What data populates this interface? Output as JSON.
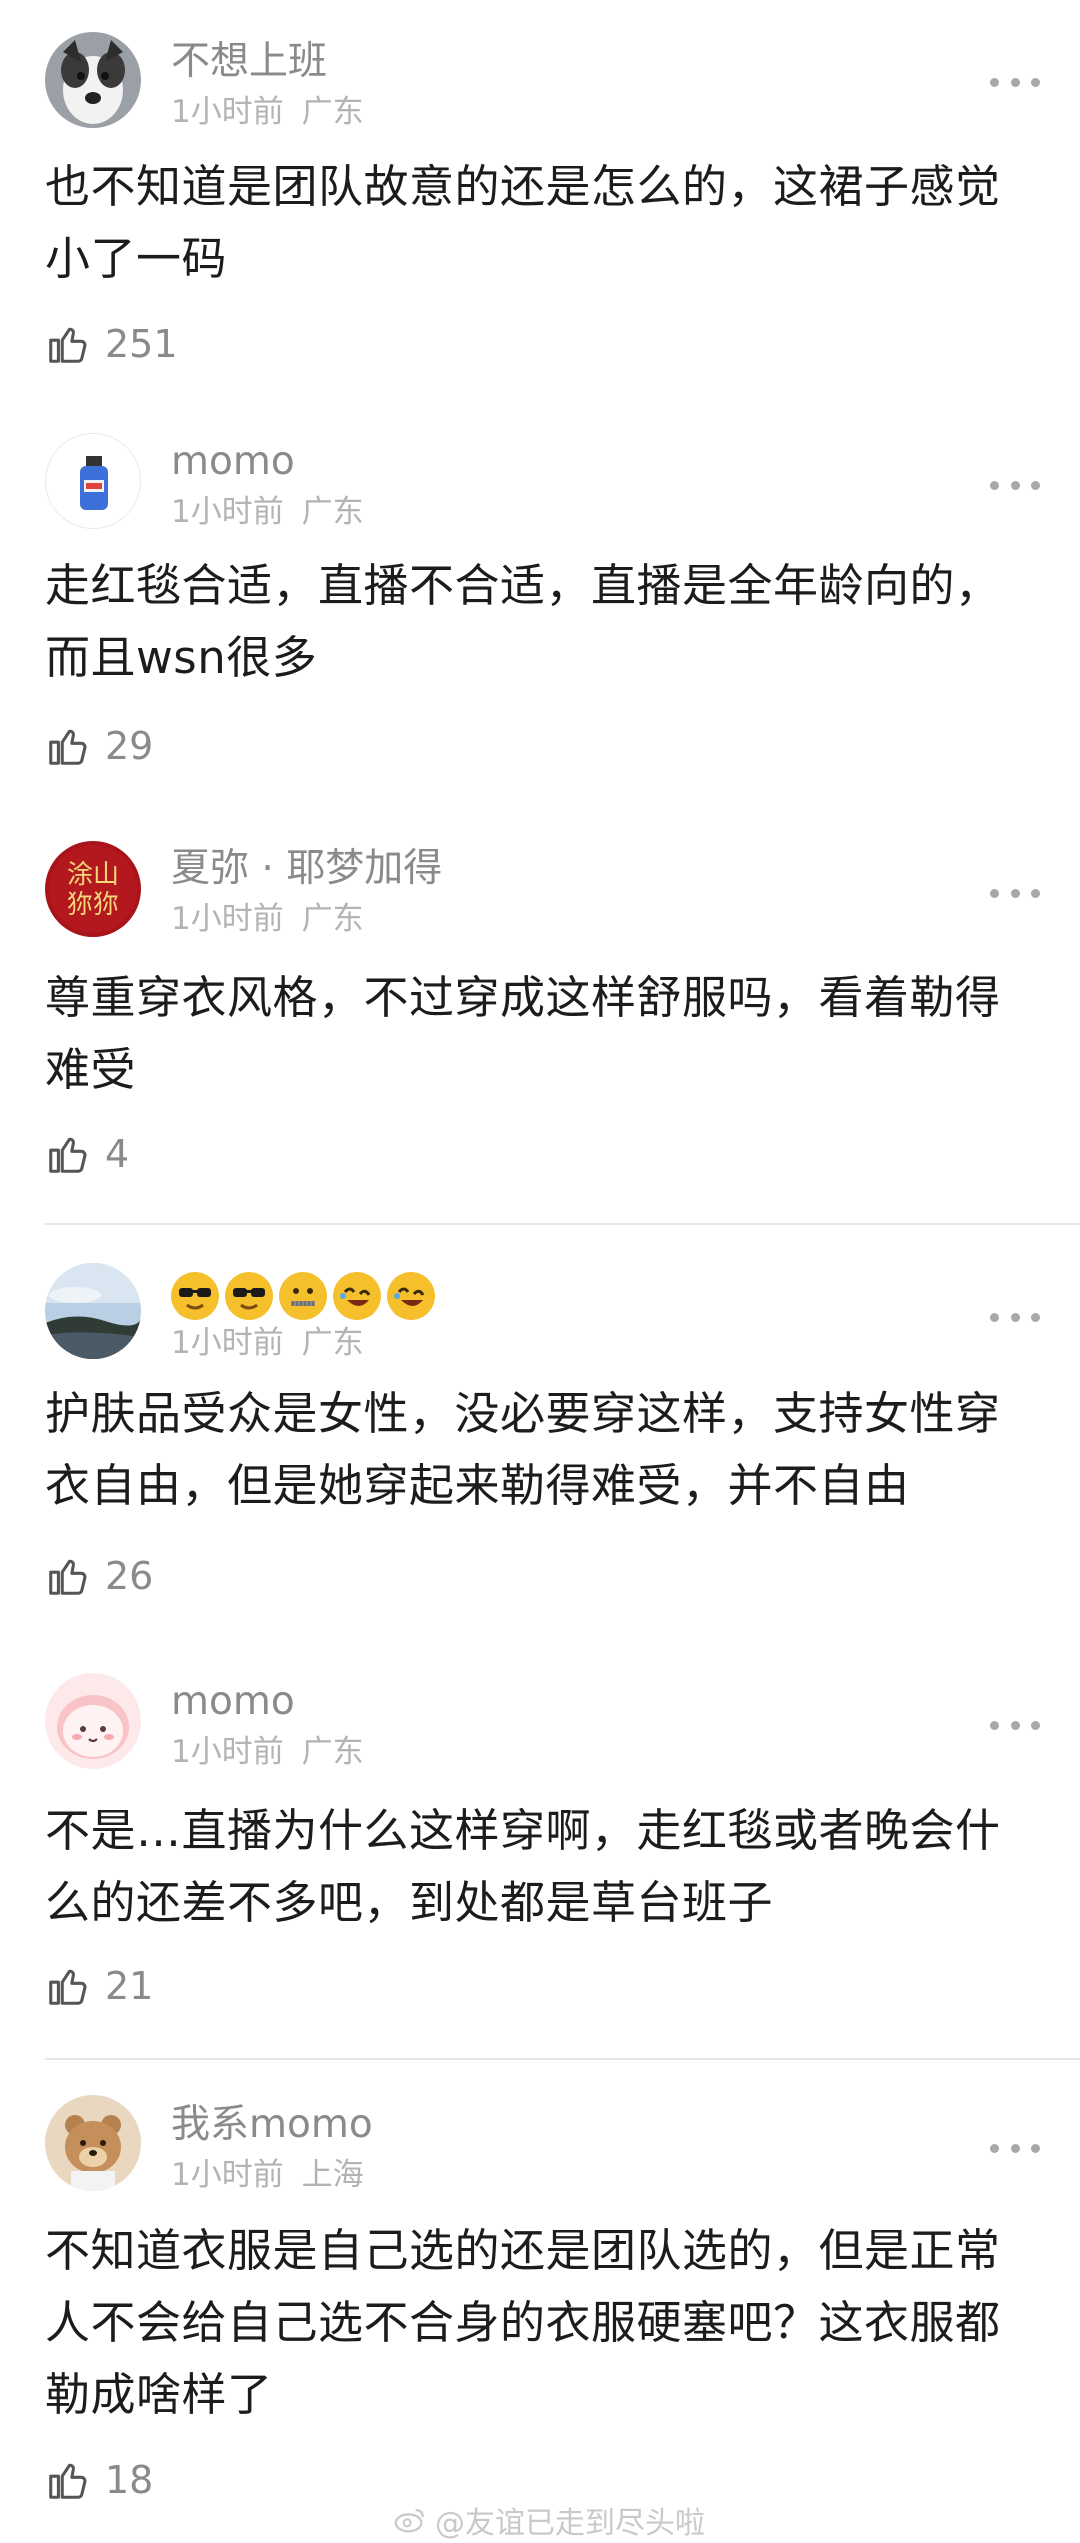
{
  "comments": [
    {
      "username": "不想上班",
      "time": "1小时前",
      "location": "广东",
      "text": "也不知道是团队故意的还是怎么的，这裙子感觉小了一码",
      "likes": "251",
      "avatar": "dog-avatar"
    },
    {
      "username": "momo",
      "time": "1小时前",
      "location": "广东",
      "text": "走红毯合适，直播不合适，直播是全年龄向的，而且wsn很多",
      "likes": "29",
      "avatar": "bottle-avatar"
    },
    {
      "username": "夏弥 · 耶梦加得",
      "time": "1小时前",
      "location": "广东",
      "text": "尊重穿衣风格，不过穿成这样舒服吗，看着勒得难受",
      "likes": "4",
      "avatar": "red-calligraphy-avatar",
      "avatar_text": "涂山\n狝狝"
    },
    {
      "username": "",
      "emojis": [
        "sunglasses-emoji",
        "sunglasses-emoji",
        "zipper-mouth-emoji",
        "rofl-emoji",
        "rofl-emoji"
      ],
      "time": "1小时前",
      "location": "广东",
      "text": "护肤品受众是女性，没必要穿这样，支持女性穿衣自由，但是她穿起来勒得难受，并不自由",
      "likes": "26",
      "avatar": "landscape-avatar"
    },
    {
      "username": "momo",
      "time": "1小时前",
      "location": "广东",
      "text": "不是…直播为什么这样穿啊，走红毯或者晚会什么的还差不多吧，到处都是草台班子",
      "likes": "21",
      "avatar": "pink-character-avatar"
    },
    {
      "username": "我系momo",
      "time": "1小时前",
      "location": "上海",
      "text": "不知道衣服是自己选的还是团队选的，但是正常人不会给自己选不合身的衣服硬塞吧？这衣服都勒成啥样了",
      "likes": "18",
      "avatar": "bear-avatar"
    }
  ],
  "watermark": "@友谊已走到尽头啦",
  "colors": {
    "username": "#8a8a8a",
    "meta": "#b3b3b3",
    "body": "#1c1c1c",
    "divider": "#e6e6e6"
  }
}
